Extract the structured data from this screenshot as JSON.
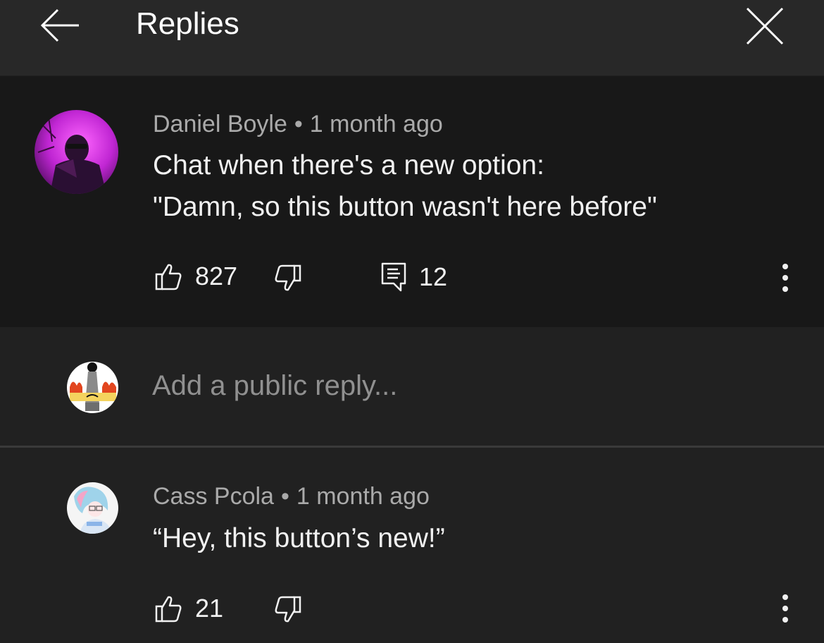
{
  "header": {
    "title": "Replies"
  },
  "parent_comment": {
    "author": "Daniel Boyle",
    "separator": "•",
    "time": "1 month ago",
    "text_line1": "Chat when there's a new option:",
    "text_line2": "\"Damn, so this button wasn't here before\"",
    "likes": "827",
    "replies": "12"
  },
  "reply_box": {
    "placeholder": "Add a public reply..."
  },
  "replies": [
    {
      "author": "Cass Pcola",
      "separator": "•",
      "time": "1 month ago",
      "text": "“Hey, this button’s new!”",
      "likes": "21"
    }
  ],
  "icons": {
    "back": "arrow-left-icon",
    "close": "close-icon",
    "like": "thumbs-up-icon",
    "dislike": "thumbs-down-icon",
    "reply": "comment-icon",
    "more": "more-vertical-icon"
  },
  "colors": {
    "header_bg": "#282828",
    "highlight_bg": "#181818",
    "page_bg": "#212121",
    "meta_text": "#aaaaaa",
    "placeholder_text": "#909090"
  }
}
